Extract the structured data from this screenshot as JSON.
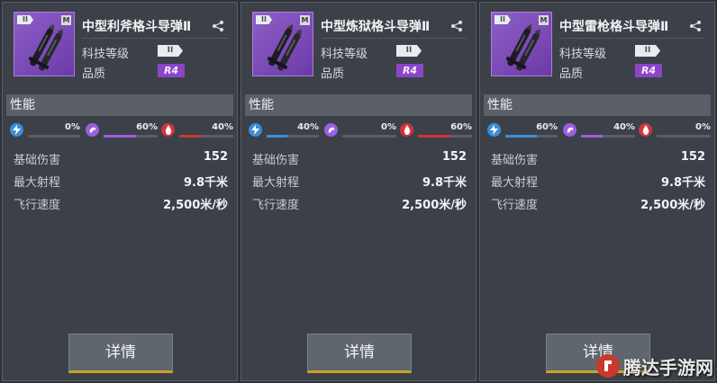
{
  "colors": {
    "electric": "#3a8fd9",
    "psionic": "#9b5fe0",
    "fire": "#d0353a"
  },
  "cards": [
    {
      "tier_badge": "II",
      "size_badge": "M",
      "title": "中型利斧格斗导弹Ⅱ",
      "tech_label": "科技等级",
      "tech_value": "II",
      "quality_label": "品质",
      "quality_value": "R4",
      "section_title": "性能",
      "attributes": [
        {
          "icon": "lightning-icon",
          "pct_text": "0%",
          "value": 0
        },
        {
          "icon": "psionic-icon",
          "pct_text": "60%",
          "value": 60
        },
        {
          "icon": "fire-drop-icon",
          "pct_text": "40%",
          "value": 40
        }
      ],
      "stats": [
        {
          "name": "基础伤害",
          "value": "152"
        },
        {
          "name": "最大射程",
          "value": "9.8千米"
        },
        {
          "name": "飞行速度",
          "value": "2,500米/秒"
        }
      ],
      "detail_button": "详情"
    },
    {
      "tier_badge": "II",
      "size_badge": "M",
      "title": "中型炼狱格斗导弹Ⅱ",
      "tech_label": "科技等级",
      "tech_value": "II",
      "quality_label": "品质",
      "quality_value": "R4",
      "section_title": "性能",
      "attributes": [
        {
          "icon": "lightning-icon",
          "pct_text": "40%",
          "value": 40
        },
        {
          "icon": "psionic-icon",
          "pct_text": "0%",
          "value": 0
        },
        {
          "icon": "fire-drop-icon",
          "pct_text": "60%",
          "value": 60
        }
      ],
      "stats": [
        {
          "name": "基础伤害",
          "value": "152"
        },
        {
          "name": "最大射程",
          "value": "9.8千米"
        },
        {
          "name": "飞行速度",
          "value": "2,500米/秒"
        }
      ],
      "detail_button": "详情"
    },
    {
      "tier_badge": "II",
      "size_badge": "M",
      "title": "中型雷枪格斗导弹Ⅱ",
      "tech_label": "科技等级",
      "tech_value": "II",
      "quality_label": "品质",
      "quality_value": "R4",
      "section_title": "性能",
      "attributes": [
        {
          "icon": "lightning-icon",
          "pct_text": "60%",
          "value": 60
        },
        {
          "icon": "psionic-icon",
          "pct_text": "40%",
          "value": 40
        },
        {
          "icon": "fire-drop-icon",
          "pct_text": "0%",
          "value": 0
        }
      ],
      "stats": [
        {
          "name": "基础伤害",
          "value": "152"
        },
        {
          "name": "最大射程",
          "value": "9.8千米"
        },
        {
          "name": "飞行速度",
          "value": "2,500米/秒"
        }
      ],
      "detail_button": "详情"
    }
  ],
  "watermark": {
    "text": "腾达手游网"
  }
}
